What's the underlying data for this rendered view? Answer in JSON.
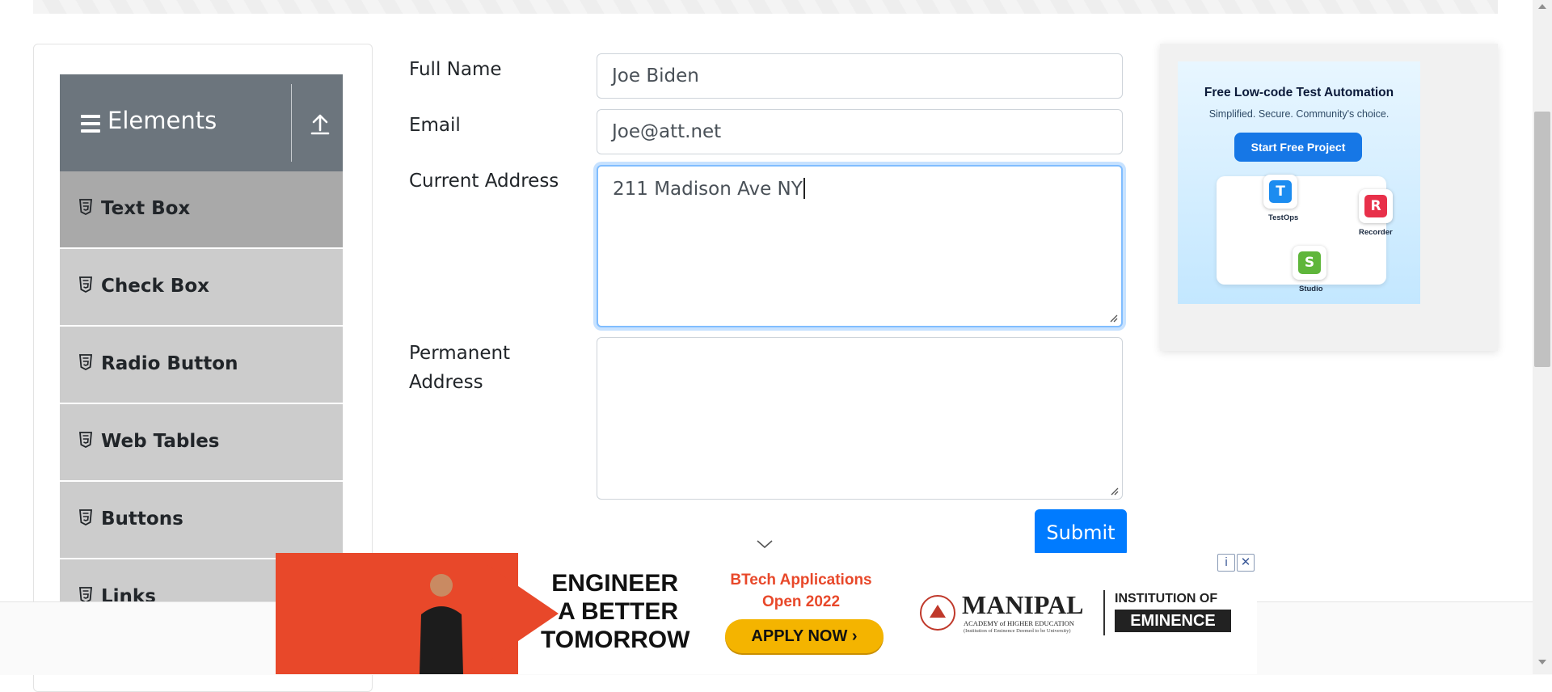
{
  "sidebar": {
    "group_title": "Elements",
    "items": [
      {
        "label": "Text Box",
        "active": true
      },
      {
        "label": "Check Box"
      },
      {
        "label": "Radio Button"
      },
      {
        "label": "Web Tables"
      },
      {
        "label": "Buttons"
      },
      {
        "label": "Links"
      }
    ]
  },
  "form": {
    "full_name": {
      "label": "Full Name",
      "value": "Joe Biden"
    },
    "email": {
      "label": "Email",
      "value": "Joe@att.net"
    },
    "current_address": {
      "label": "Current Address",
      "value": "211 Madison Ave NY"
    },
    "permanent_address": {
      "label_line1": "Permanent",
      "label_line2": "Address",
      "value": ""
    },
    "submit_label": "Submit"
  },
  "side_ad": {
    "headline": "Free Low-code Test Automation",
    "subline": "Simplified. Secure. Community's choice.",
    "button": "Start Free Project",
    "tiles": [
      {
        "letter": "T",
        "label": "TestOps",
        "color": "#1c8cf0"
      },
      {
        "letter": "R",
        "label": "Recorder",
        "color": "#e8304a"
      },
      {
        "letter": "S",
        "label": "Studio",
        "color": "#5fb63b"
      }
    ]
  },
  "bottom_ad": {
    "line1": "ENGINEER",
    "line2": "A BETTER",
    "line3": "TOMORROW",
    "btech_line1": "BTech Applications",
    "btech_line2": "Open 2022",
    "apply": "APPLY NOW ›",
    "brand": "MANIPAL",
    "brand_sub1": "ACADEMY of HIGHER EDUCATION",
    "brand_sub2": "(Institution of Eminence Deemed to be University)",
    "inst_line1": "INSTITUTION OF",
    "inst_line2": "EMINENCE",
    "adchoices_info": "i",
    "adchoices_close": "✕"
  },
  "colors": {
    "header_bg": "#6c757d",
    "menu_bg": "#cccccc",
    "menu_active_bg": "#a9a9a9",
    "submit_bg": "#007bff",
    "focus_border": "#80bdff"
  }
}
